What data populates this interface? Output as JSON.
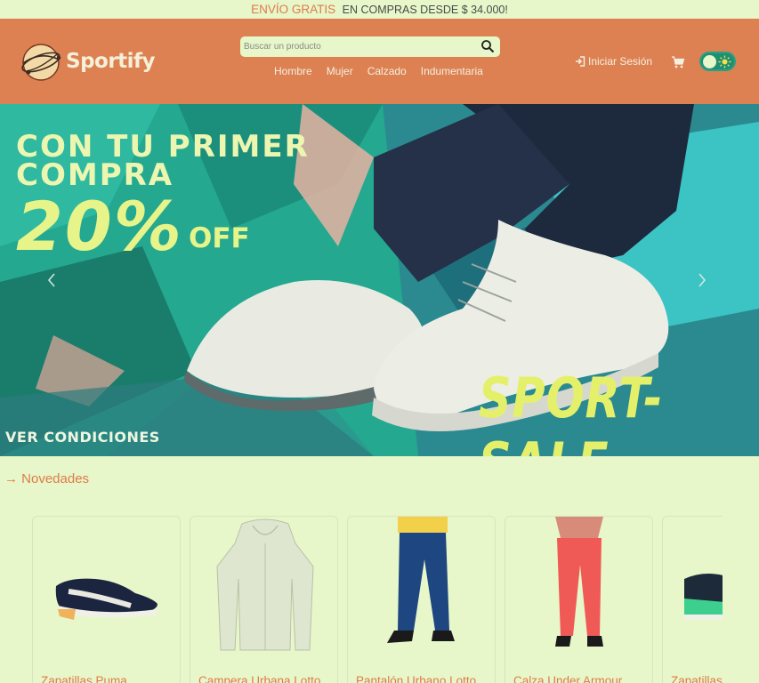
{
  "promo": {
    "highlight": "ENVÍO GRATIS",
    "text": "EN COMPRAS DESDE $ 34.000!"
  },
  "header": {
    "logo_text": "Sportify",
    "search_placeholder": "Buscar un producto",
    "nav": [
      "Hombre",
      "Mujer",
      "Calzado",
      "Indumentaria"
    ],
    "login_label": "Iniciar Sesión",
    "theme_toggle": "on"
  },
  "hero": {
    "line1": "CON TU PRIMER",
    "line2": "COMPRA",
    "discount": "20%",
    "off": "OFF",
    "sale": "SPORT-SALE",
    "conditions": "VER CONDICIONES"
  },
  "section": {
    "title": "→ Novedades"
  },
  "products": [
    {
      "title": "Zapatillas Puma"
    },
    {
      "title": "Campera Urbana Lotto"
    },
    {
      "title": "Pantalón Urbano Lotto"
    },
    {
      "title": "Calza Under Armour"
    },
    {
      "title": "Zapatillas"
    }
  ],
  "colors": {
    "header": "#dd8152",
    "accent": "#e07a4c",
    "background": "#e7f7c9",
    "toggle": "#1f8f73"
  }
}
